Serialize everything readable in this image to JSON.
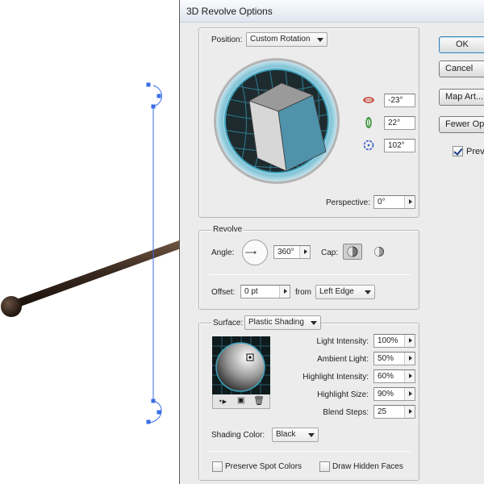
{
  "dialog": {
    "title": "3D Revolve Options"
  },
  "buttons": {
    "ok": "OK",
    "cancel": "Cancel",
    "map_art": "Map Art...",
    "fewer_options": "Fewer Options",
    "preview": "Preview"
  },
  "position": {
    "label": "Position:",
    "value": "Custom Rotation",
    "rotate_x": "-23°",
    "rotate_y": "22°",
    "rotate_z": "102°",
    "perspective_label": "Perspective:",
    "perspective_value": "0°"
  },
  "revolve": {
    "title": "Revolve",
    "angle_label": "Angle:",
    "angle_value": "360°",
    "cap_label": "Cap:",
    "offset_label": "Offset:",
    "offset_value": "0 pt",
    "from_label": "from",
    "from_value": "Left Edge"
  },
  "surface": {
    "label": "Surface:",
    "value": "Plastic Shading",
    "light_intensity_label": "Light Intensity:",
    "light_intensity": "100%",
    "ambient_light_label": "Ambient Light:",
    "ambient_light": "50%",
    "highlight_intensity_label": "Highlight Intensity:",
    "highlight_intensity": "60%",
    "highlight_size_label": "Highlight Size:",
    "highlight_size": "90%",
    "blend_steps_label": "Blend Steps:",
    "blend_steps": "25",
    "shading_color_label": "Shading Color:",
    "shading_color": "Black",
    "preserve_spot_label": "Preserve Spot Colors",
    "draw_hidden_label": "Draw Hidden Faces"
  },
  "colors": {
    "cube_front": "#4f92aa",
    "cube_top": "#9a9a9a",
    "cube_side": "#d7d7d7",
    "rod": "#3a2a20",
    "selection": "#3a6ee8"
  }
}
